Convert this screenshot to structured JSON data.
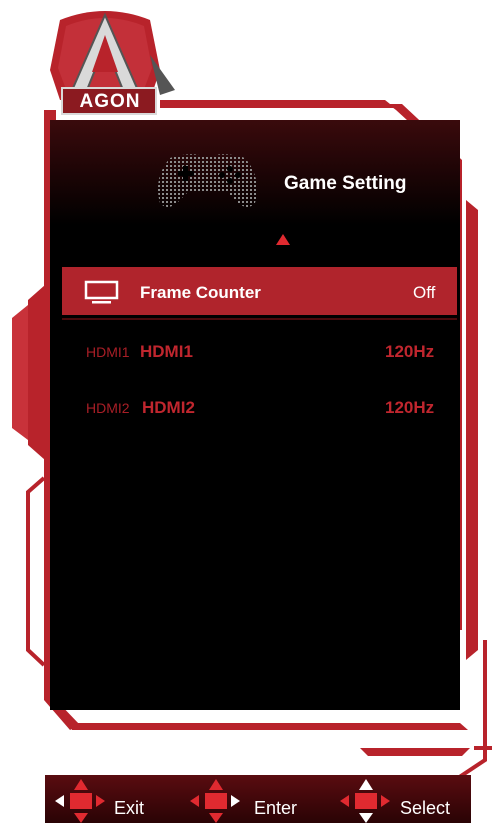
{
  "brand": {
    "logo_text": "AGON"
  },
  "header": {
    "title": "Game Setting"
  },
  "menu": {
    "selected": {
      "label": "Frame Counter",
      "value": "Off",
      "icon": "monitor-icon"
    },
    "rows": [
      {
        "small": "HDMI1",
        "label": "HDMI1",
        "value": "120Hz"
      },
      {
        "small": "HDMI2",
        "label": "HDMI2",
        "value": "120Hz"
      }
    ]
  },
  "footer": {
    "exit_label": "Exit",
    "enter_label": "Enter",
    "select_label": "Select"
  },
  "colors": {
    "accent_red": "#b0242c",
    "text_red": "#c0262e",
    "background": "#000000",
    "frame_red": "#b8232b"
  }
}
